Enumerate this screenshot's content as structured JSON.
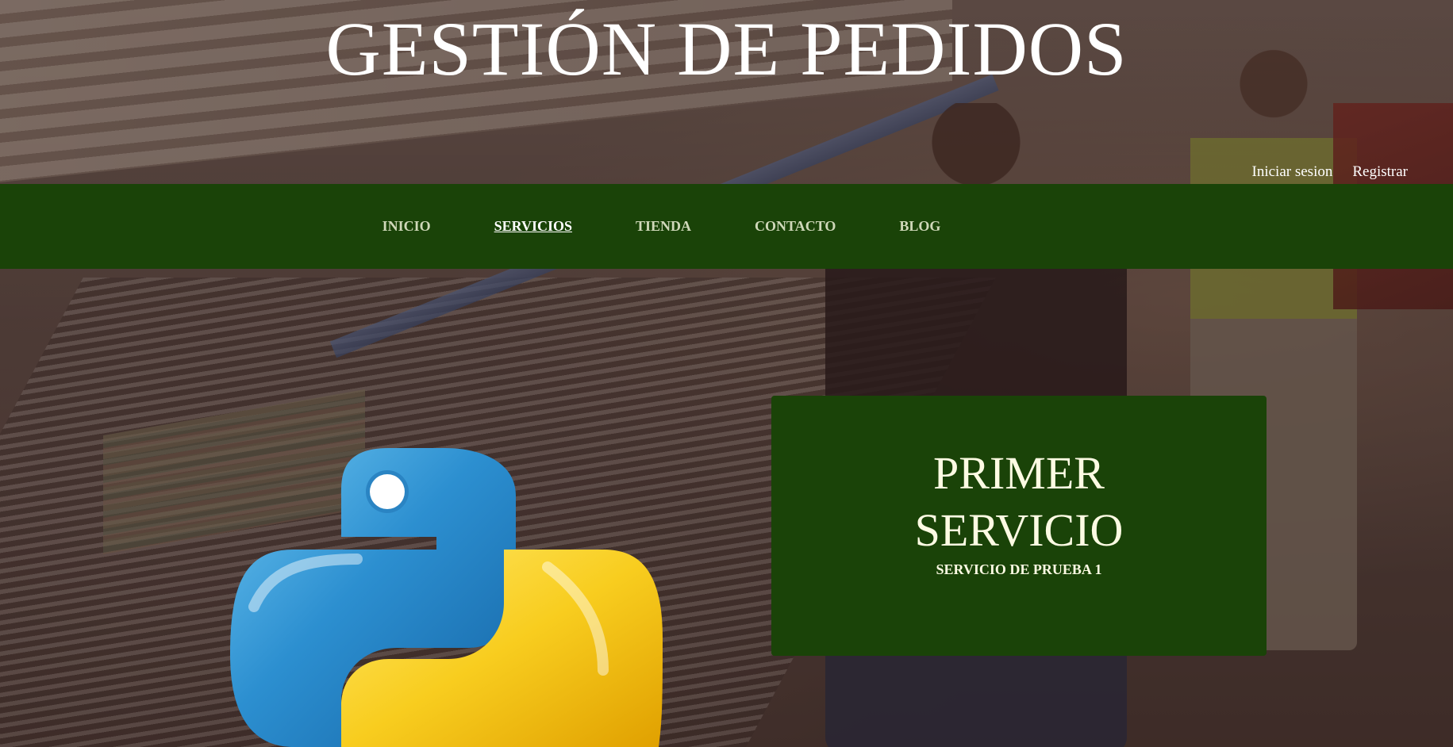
{
  "header": {
    "title": "GESTIÓN DE PEDIDOS",
    "login_label": "Iniciar sesion",
    "register_label": "Registrar"
  },
  "nav": {
    "items": [
      {
        "label": "INICIO",
        "active": false
      },
      {
        "label": "SERVICIOS",
        "active": true
      },
      {
        "label": "TIENDA",
        "active": false
      },
      {
        "label": "CONTACTO",
        "active": false
      },
      {
        "label": "BLOG",
        "active": false
      }
    ]
  },
  "service": {
    "title_line1": "PRIMER",
    "title_line2": "SERVICIO",
    "subtitle": "SERVICIO DE PRUEBA 1",
    "image_icon": "python-logo-icon"
  },
  "colors": {
    "nav_background": "#1a4308",
    "card_background": "#1a4308",
    "nav_link": "#cfd8b9",
    "nav_active": "#ffffff",
    "card_text": "#fdfbe3",
    "python_blue": "#2f86c5",
    "python_yellow": "#f6c71d"
  }
}
